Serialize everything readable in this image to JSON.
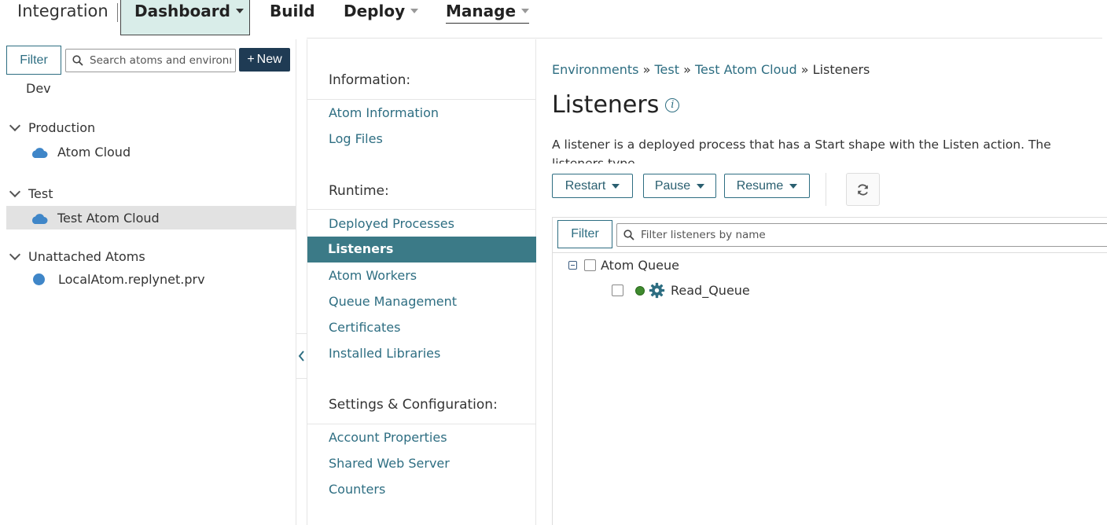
{
  "topnav": {
    "brand": "Integration",
    "tabs": [
      {
        "label": "Dashboard"
      },
      {
        "label": "Build"
      },
      {
        "label": "Deploy"
      },
      {
        "label": "Manage"
      }
    ]
  },
  "sidebar": {
    "filter_label": "Filter",
    "search_placeholder": "Search atoms and environments",
    "new_label": "New",
    "tree": {
      "dev": "Dev",
      "production": "Production",
      "production_item": "Atom Cloud",
      "test": "Test",
      "test_item": "Test Atom Cloud",
      "unattached": "Unattached Atoms",
      "unattached_item": "LocalAtom.replynet.prv"
    }
  },
  "midnav": {
    "information_heading": "Information:",
    "information_items": [
      "Atom Information",
      "Log Files"
    ],
    "runtime_heading": "Runtime:",
    "runtime_items": [
      "Deployed Processes",
      "Listeners",
      "Atom Workers",
      "Queue Management",
      "Certificates",
      "Installed Libraries"
    ],
    "settings_heading": "Settings & Configuration:",
    "settings_items": [
      "Account Properties",
      "Shared Web Server",
      "Counters"
    ]
  },
  "main": {
    "breadcrumb": [
      "Environments",
      "Test",
      "Test Atom Cloud",
      "Listeners"
    ],
    "breadcrumb_sep": "»",
    "title": "Listeners",
    "description": "A listener is a deployed process that has a Start shape with the Listen action. The listeners type",
    "actions": {
      "restart": "Restart",
      "pause": "Pause",
      "resume": "Resume"
    },
    "list": {
      "filter_label": "Filter",
      "search_placeholder": "Filter listeners by name",
      "group": "Atom Queue",
      "listener": "Read_Queue"
    }
  },
  "colors": {
    "accent": "#2e6e82",
    "active_nav": "#3b7a87",
    "new_button": "#1f3b54",
    "status_running": "#3f8a2e"
  }
}
